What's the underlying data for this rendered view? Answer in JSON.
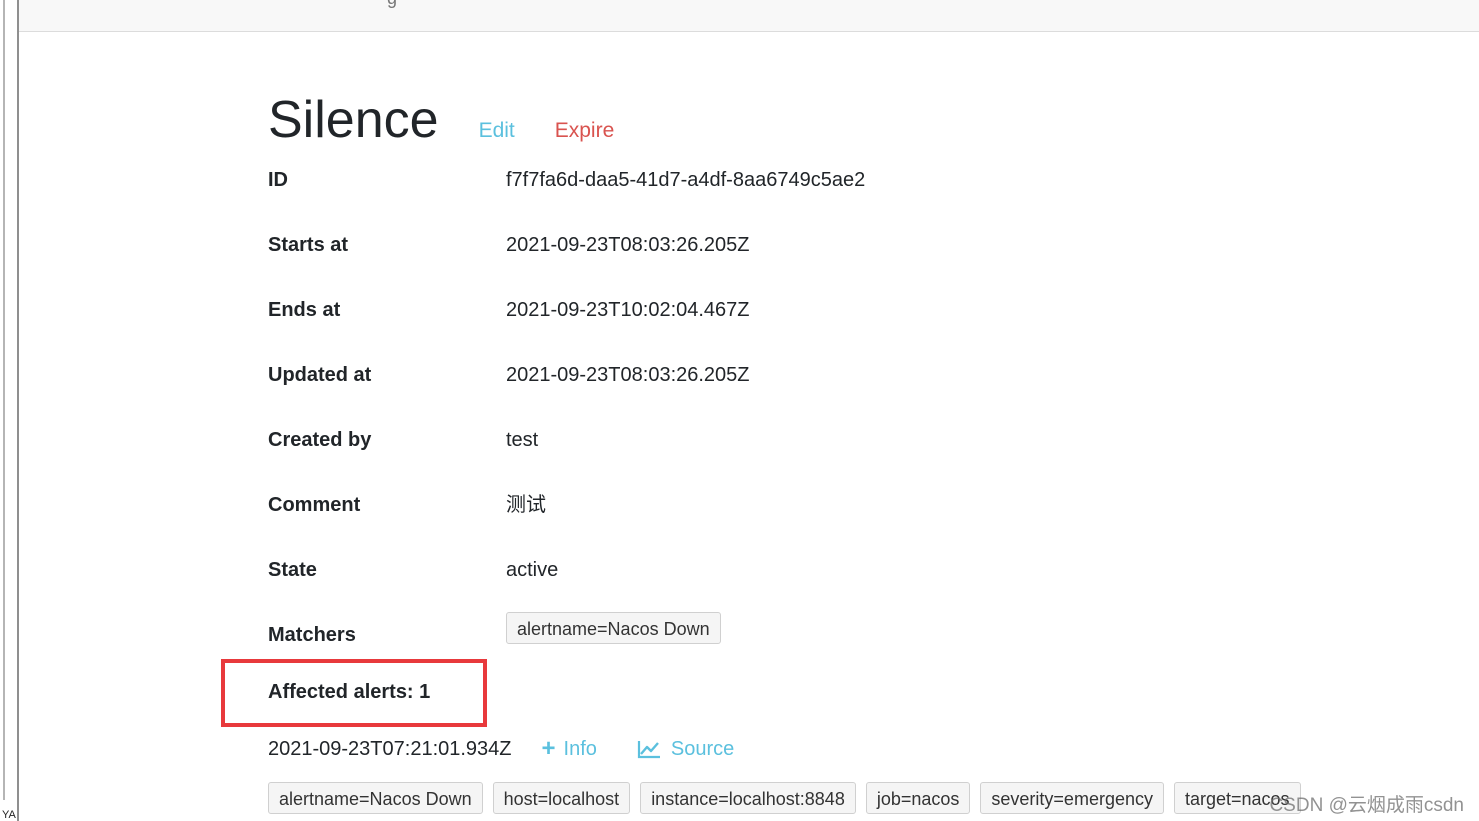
{
  "sidebar_edge": {
    "text": "YA"
  },
  "topbar": {
    "nav_fragment": "g"
  },
  "header": {
    "title": "Silence",
    "edit_label": "Edit",
    "expire_label": "Expire"
  },
  "details": {
    "id": {
      "label": "ID",
      "value": "f7f7fa6d-daa5-41d7-a4df-8aa6749c5ae2"
    },
    "starts_at": {
      "label": "Starts at",
      "value": "2021-09-23T08:03:26.205Z"
    },
    "ends_at": {
      "label": "Ends at",
      "value": "2021-09-23T10:02:04.467Z"
    },
    "updated_at": {
      "label": "Updated at",
      "value": "2021-09-23T08:03:26.205Z"
    },
    "created_by": {
      "label": "Created by",
      "value": "test"
    },
    "comment": {
      "label": "Comment",
      "value": "测试"
    },
    "state": {
      "label": "State",
      "value": "active"
    },
    "matchers": {
      "label": "Matchers",
      "items": [
        "alertname=Nacos Down"
      ]
    }
  },
  "affected": {
    "label": "Affected alerts: 1",
    "alert": {
      "timestamp": "2021-09-23T07:21:01.934Z",
      "info_label": "Info",
      "source_label": "Source",
      "labels": [
        "alertname=Nacos Down",
        "host=localhost",
        "instance=localhost:8848",
        "job=nacos",
        "severity=emergency",
        "target=nacos"
      ]
    }
  },
  "watermark": "CSDN @云烟成雨csdn",
  "colors": {
    "link_info": "#5bc0de",
    "link_danger": "#d9534f",
    "highlight": "#e8393c"
  }
}
